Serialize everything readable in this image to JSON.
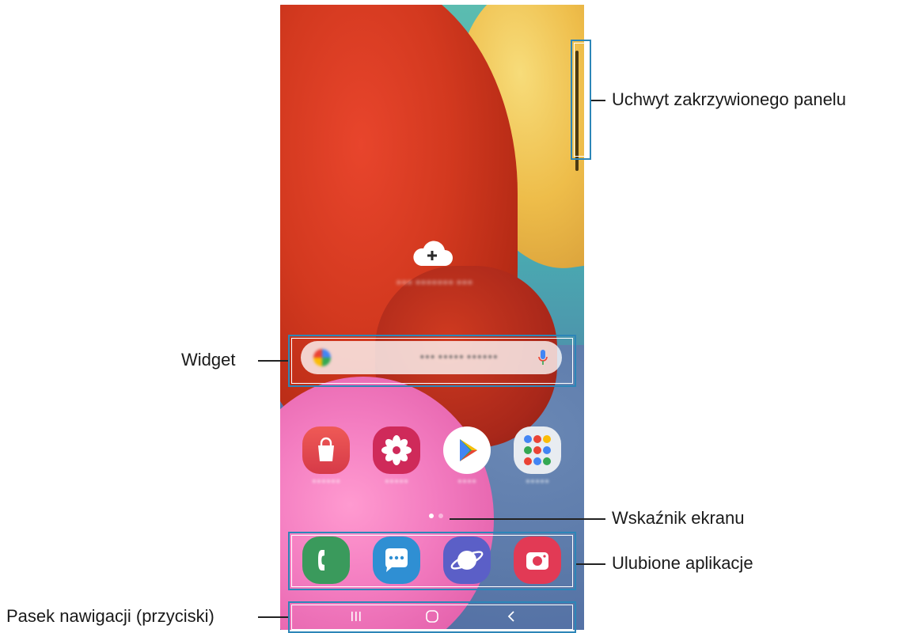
{
  "callouts": {
    "edge_panel_handle": "Uchwyt zakrzywionego panelu",
    "widget": "Widget",
    "page_indicator": "Wskaźnik ekranu",
    "favorite_apps": "Ulubione aplikacje",
    "navigation_bar": "Pasek nawigacji (przyciski)"
  },
  "colors": {
    "callout_box": "#2c86b8",
    "leader_line": "#222222"
  },
  "home_screen": {
    "weather_icon": "cloud-plus-icon",
    "search_mic_icon": "microphone-icon",
    "apps_row": [
      {
        "name": "galaxy-store-icon",
        "color": "#e2463f"
      },
      {
        "name": "gallery-icon",
        "color": "#cc2a5c"
      },
      {
        "name": "play-store-icon",
        "color": "#ffffff"
      },
      {
        "name": "google-folder-icon",
        "color": "#e8ecf1"
      }
    ],
    "dock": [
      {
        "name": "phone-icon",
        "color": "#3a9a5c"
      },
      {
        "name": "messages-icon",
        "color": "#2f8fd3"
      },
      {
        "name": "internet-icon",
        "color": "#5b5fc7"
      },
      {
        "name": "camera-icon",
        "color": "#e23a55"
      }
    ],
    "nav_buttons": [
      "recents-icon",
      "home-icon",
      "back-icon"
    ]
  }
}
